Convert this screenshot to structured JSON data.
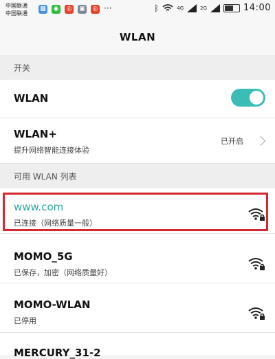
{
  "status_bar": {
    "carriers": [
      "中国联通",
      "中国联通"
    ],
    "clock": "14:00",
    "net_labels": [
      "4G",
      "2G"
    ]
  },
  "title": "WLAN",
  "sections": {
    "switch_header": "开关",
    "list_header": "可用 WLAN 列表"
  },
  "wlan_toggle": {
    "label": "WLAN",
    "enabled": true
  },
  "wlan_plus": {
    "label": "WLAN+",
    "subtitle": "提升网络智能连接体验",
    "value": "已开启"
  },
  "networks": [
    {
      "ssid": "www.com",
      "status": "已连接（网络质量一般）",
      "connected": true
    },
    {
      "ssid": "MOMO_5G",
      "status": "已保存，加密（网络质量好）",
      "connected": false
    },
    {
      "ssid": "MOMO-WLAN",
      "status": "已停用",
      "connected": false
    },
    {
      "ssid": "MERCURY_31-2",
      "status": "",
      "connected": false
    }
  ],
  "colors": {
    "accent": "#3bbdb5",
    "highlight": "#d7262e",
    "connected_text": "#2aa7a0"
  },
  "icons": [
    "bluetooth-icon",
    "wifi-icon",
    "signal-icon",
    "battery-icon",
    "lock-icon",
    "chevron-right-icon"
  ]
}
